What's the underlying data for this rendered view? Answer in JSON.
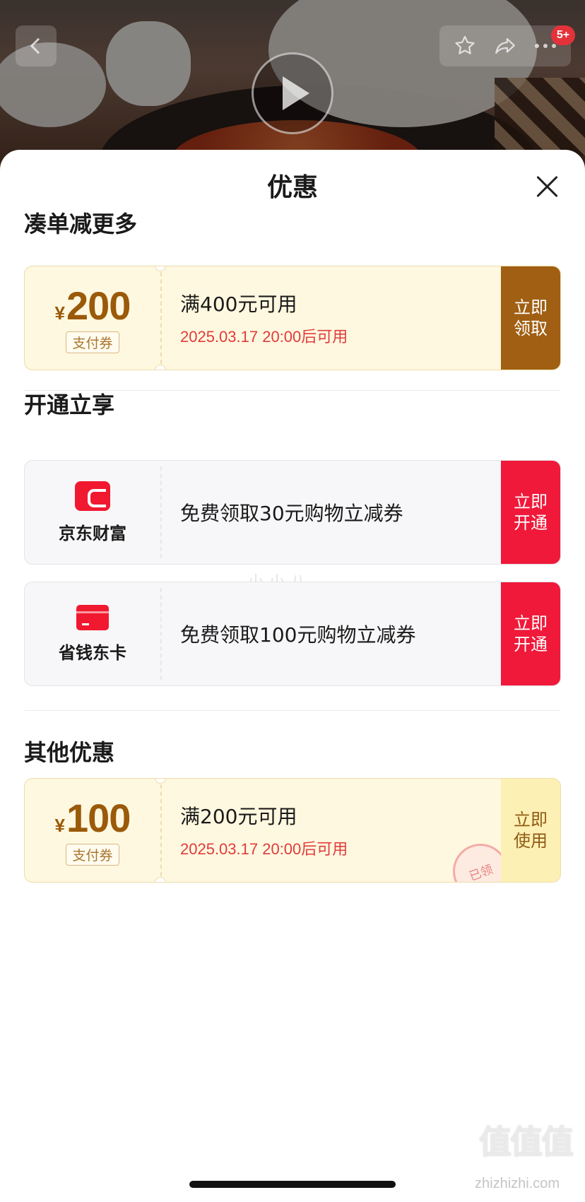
{
  "hero": {
    "badge": "5+",
    "icons": [
      "back-icon",
      "star-icon",
      "share-icon",
      "more-icon",
      "play-icon"
    ]
  },
  "sheet": {
    "title": "优惠",
    "close_icon": "close-icon"
  },
  "sections": {
    "bundle": {
      "title": "凑单减更多",
      "coupon": {
        "currency": "¥",
        "amount": "200",
        "tag": "支付券",
        "condition": "满400元可用",
        "time": "2025.03.17 20:00后可用",
        "action": "立即领取"
      }
    },
    "activate": {
      "title": "开通立享",
      "items": [
        {
          "brand": "京东财富",
          "icon": "jd-wealth-icon",
          "promo": "免费领取30元购物立减券",
          "action": "立即开通"
        },
        {
          "brand": "省钱东卡",
          "icon": "card-icon",
          "promo": "免费领取100元购物立减券",
          "action": "立即开通"
        }
      ]
    },
    "other": {
      "title": "其他优惠",
      "coupon": {
        "currency": "¥",
        "amount": "100",
        "tag": "支付券",
        "condition": "满200元可用",
        "time": "2025.03.17 20:00后可用",
        "action": "立即使用",
        "stamp": "已领"
      }
    }
  },
  "watermark": {
    "middle": "小小八",
    "logo": "值值值",
    "url": "zhizhizhi.com"
  },
  "colors": {
    "brown_action": "#a05f12",
    "red_action": "#f0193a",
    "gold_bg": "#fff8e0",
    "time_red": "#e03b3b"
  }
}
